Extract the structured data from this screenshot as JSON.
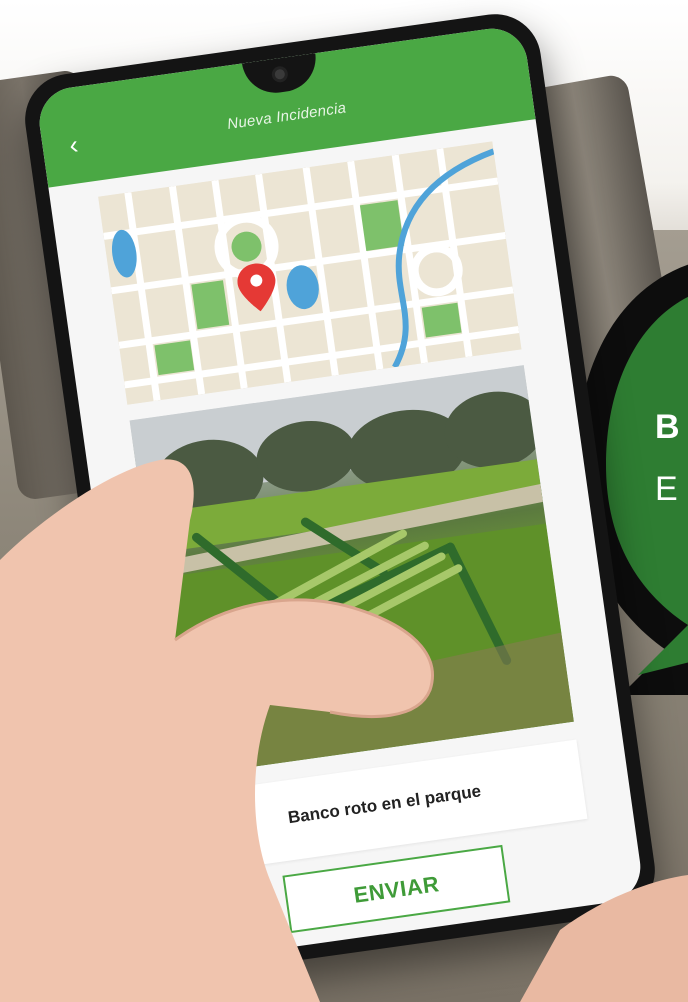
{
  "app": {
    "screen_title": "Nueva Incidencia",
    "back_icon": "chevron-left-icon",
    "description": "Banco roto en el parque",
    "submit_label": "ENVIAR"
  },
  "bubble": {
    "line1": "B",
    "line2": "E"
  },
  "colors": {
    "header_green": "#4aa844",
    "button_green": "#3f9b38",
    "bubble_green": "#2e7d32",
    "map_pin": "#e53935"
  }
}
